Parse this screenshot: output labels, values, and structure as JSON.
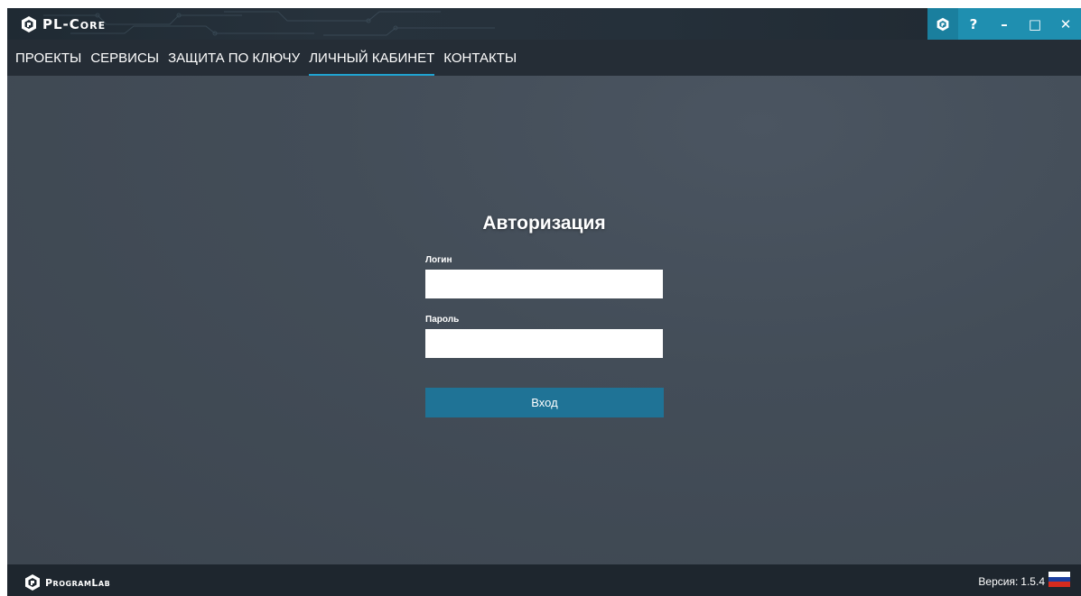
{
  "app": {
    "title": "PL-Core"
  },
  "window_controls": {
    "help": "?",
    "minimize": "–",
    "maximize": "□",
    "close": "✕"
  },
  "nav": {
    "items": [
      {
        "label": "ПРОЕКТЫ",
        "active": false
      },
      {
        "label": "СЕРВИСЫ",
        "active": false
      },
      {
        "label": "ЗАЩИТА ПО КЛЮЧУ",
        "active": false
      },
      {
        "label": "ЛИЧНЫЙ КАБИНЕТ",
        "active": true
      },
      {
        "label": "КОНТАКТЫ",
        "active": false
      }
    ]
  },
  "auth": {
    "title": "Авторизация",
    "login_label": "Логин",
    "login_value": "",
    "password_label": "Пароль",
    "password_value": "",
    "submit_label": "Вход"
  },
  "footer": {
    "brand": "ProgramLab",
    "version_label": "Версия:",
    "version_number": "1.5.4",
    "language_flag": "russian-flag-icon"
  },
  "colors": {
    "accent": "#1f8fb0",
    "button": "#1f7396",
    "nav_underline": "#1fa3d1",
    "background": "#404a55",
    "flag_white": "#ffffff",
    "flag_blue": "#1c3f9e",
    "flag_red": "#d52b1e"
  }
}
